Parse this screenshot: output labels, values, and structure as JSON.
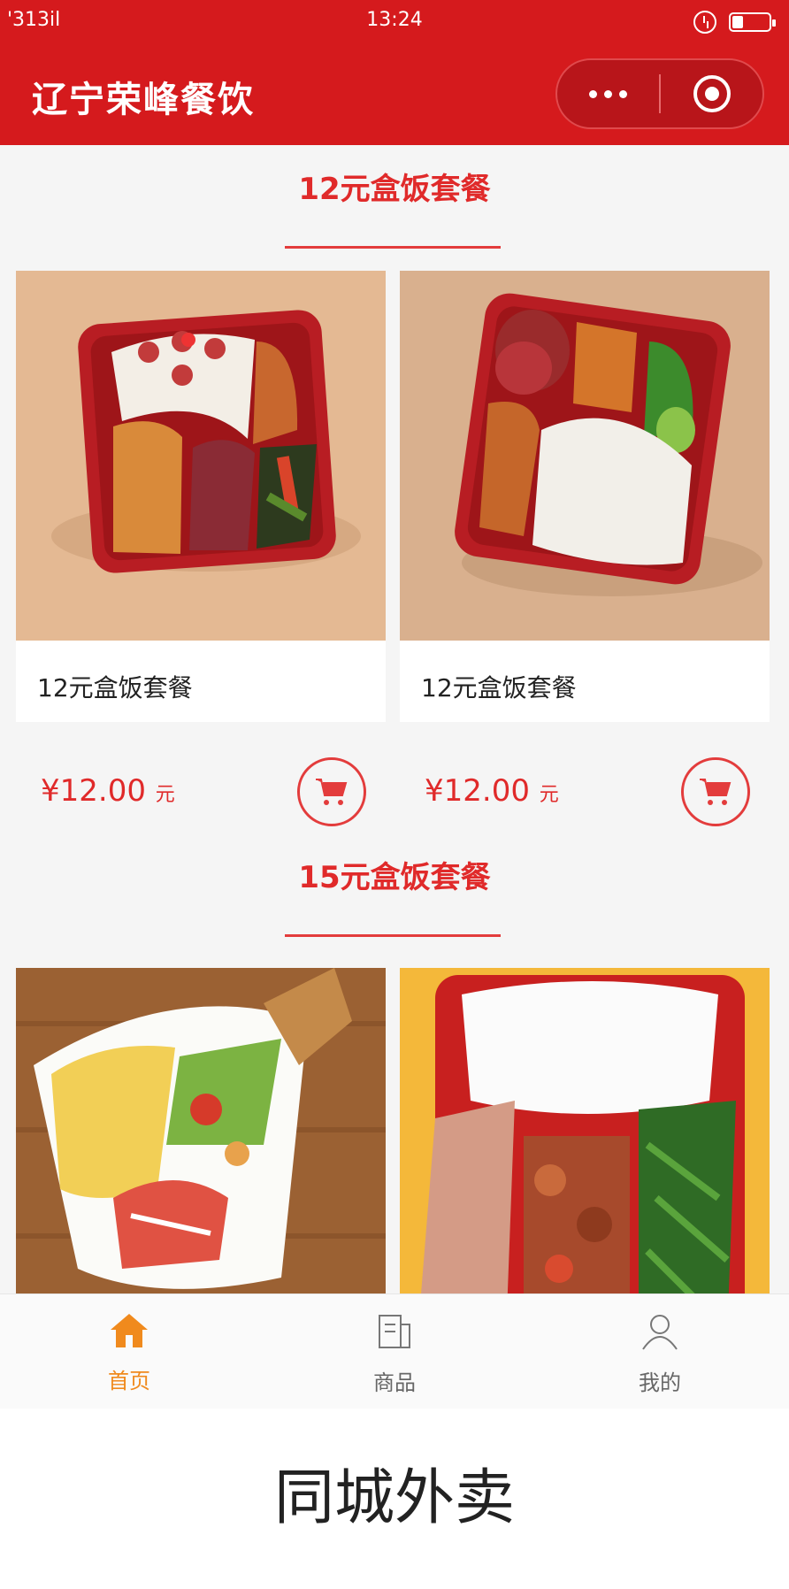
{
  "status_bar": {
    "signal": "'313il",
    "time": "13:24"
  },
  "header": {
    "title": "辽宁荣峰餐饮"
  },
  "sections": [
    {
      "title": "12元盒饭套餐",
      "products": [
        {
          "name": "12元盒饭套餐",
          "price": "¥12.00",
          "unit": "元"
        },
        {
          "name": "12元盒饭套餐",
          "price": "¥12.00",
          "unit": "元"
        }
      ]
    },
    {
      "title": "15元盒饭套餐",
      "products": [
        {},
        {}
      ]
    }
  ],
  "tabbar": [
    {
      "label": "首页",
      "icon": "home-icon",
      "active": true
    },
    {
      "label": "商品",
      "icon": "goods-icon",
      "active": false
    },
    {
      "label": "我的",
      "icon": "user-icon",
      "active": false
    }
  ],
  "caption": "同城外卖",
  "colors": {
    "brand": "#d51a1d",
    "accent": "#e02a2a",
    "tab_active": "#f08a1d"
  }
}
